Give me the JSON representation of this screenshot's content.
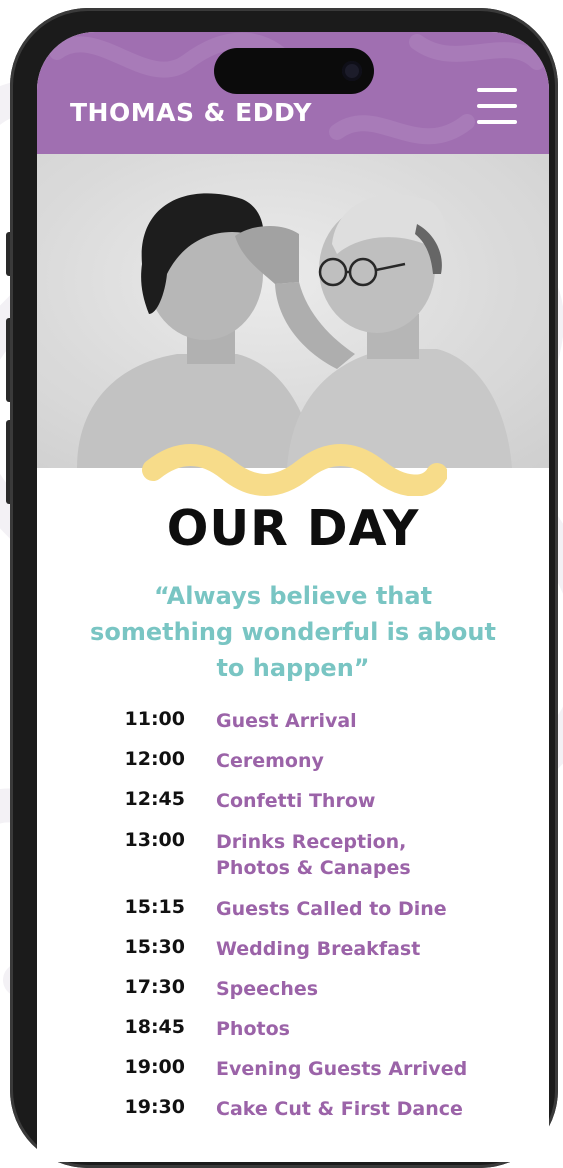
{
  "header": {
    "brand": "THOMAS & EDDY",
    "menu_icon": "hamburger-menu-icon",
    "background_color": "#a06fb1"
  },
  "hero": {
    "image_description_icon": "couple-photo",
    "accent_wave_color": "#f7dc8a"
  },
  "section": {
    "title": "OUR DAY",
    "quote": "“Always believe that something wonderful is about to happen”",
    "quote_color": "#79c5c3"
  },
  "schedule": [
    {
      "time": "11:00",
      "event": "Guest Arrival"
    },
    {
      "time": "12:00",
      "event": "Ceremony"
    },
    {
      "time": "12:45",
      "event": "Confetti Throw"
    },
    {
      "time": "13:00",
      "event": "Drinks Reception, Photos & Canapes"
    },
    {
      "time": "15:15",
      "event": "Guests Called to Dine"
    },
    {
      "time": "15:30",
      "event": "Wedding Breakfast"
    },
    {
      "time": "17:30",
      "event": "Speeches"
    },
    {
      "time": "18:45",
      "event": "Photos"
    },
    {
      "time": "19:00",
      "event": "Evening Guests Arrived"
    },
    {
      "time": "19:30",
      "event": "Cake Cut & First Dance"
    }
  ],
  "colors": {
    "event_text": "#9b63a8",
    "time_text": "#111111"
  }
}
